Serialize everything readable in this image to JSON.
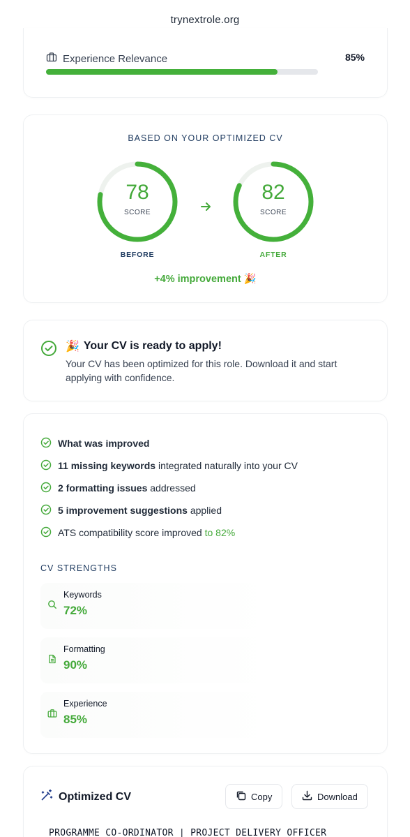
{
  "browser": {
    "url": "trynextrole.org"
  },
  "experience_card": {
    "label": "Experience Relevance",
    "percent": "85%",
    "bar_fill_fraction": 0.85
  },
  "score_card": {
    "title": "BASED ON YOUR OPTIMIZED CV",
    "before": {
      "value": "78",
      "sub": "SCORE",
      "caption": "BEFORE",
      "ring_fraction": 0.78
    },
    "after": {
      "value": "82",
      "sub": "SCORE",
      "caption": "AFTER",
      "ring_fraction": 0.82
    },
    "improvement": "+4% improvement",
    "colors": {
      "green": "#44a93a",
      "navy": "#1e3a5f",
      "track": "#eef2ee"
    }
  },
  "ready_card": {
    "title": "Your CV is ready to apply!",
    "body": "Your CV has been optimized for this role. Download it and start applying with confidence."
  },
  "improved_card": {
    "heading": "What was improved",
    "items": [
      {
        "bold": "11 missing keywords",
        "rest": " integrated naturally into your CV",
        "hl": ""
      },
      {
        "bold": "2 formatting issues",
        "rest": " addressed",
        "hl": ""
      },
      {
        "bold": "5 improvement suggestions",
        "rest": " applied",
        "hl": ""
      },
      {
        "bold": "",
        "rest": "ATS compatibility score improved ",
        "hl": "to 82%"
      }
    ],
    "strengths_heading": "CV STRENGTHS",
    "strengths": [
      {
        "label": "Keywords",
        "value": "72%",
        "icon": "search-icon"
      },
      {
        "label": "Formatting",
        "value": "90%",
        "icon": "document-icon"
      },
      {
        "label": "Experience",
        "value": "85%",
        "icon": "briefcase-icon"
      }
    ]
  },
  "cv_card": {
    "title": "Optimized CV",
    "copy_label": "Copy",
    "download_label": "Download",
    "first_line": "PROGRAMME CO-ORDINATOR | PROJECT DELIVERY OFFICER"
  }
}
